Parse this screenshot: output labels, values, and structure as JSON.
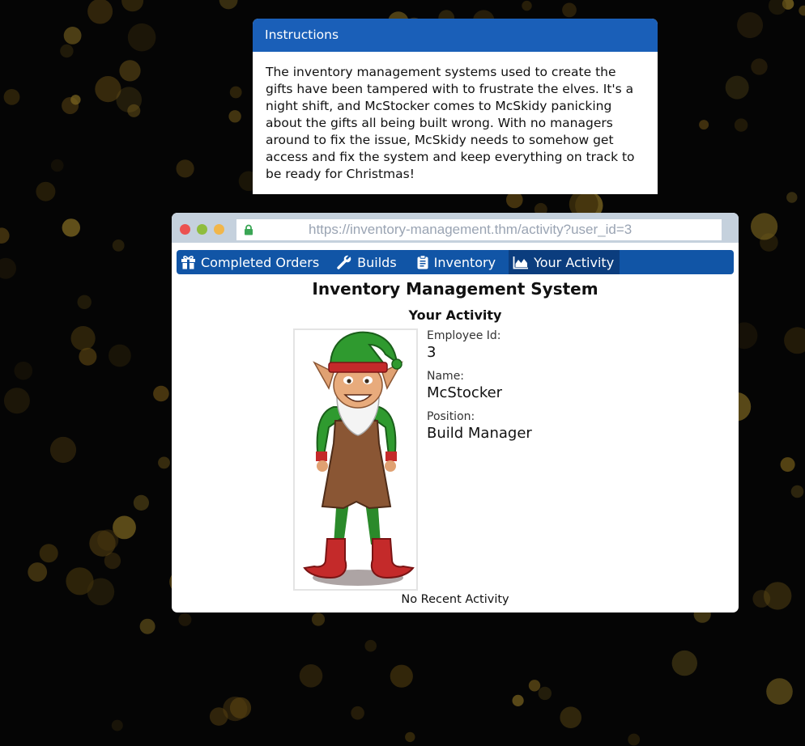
{
  "instructions": {
    "heading": "Instructions",
    "body": "The inventory management systems used to create the gifts have been tampered with to frustrate the elves. It's a night shift, and McStocker comes to McSkidy panicking about the gifts all being built wrong. With no managers around to fix the issue, McSkidy needs to somehow get access and fix the system and keep everything on track to be ready for Christmas!"
  },
  "browser": {
    "url": "https://inventory-management.thm/activity?user_id=3",
    "lock_icon": "lock-icon"
  },
  "nav": {
    "items": [
      {
        "label": "Completed Orders",
        "icon": "gift-icon"
      },
      {
        "label": "Builds",
        "icon": "wrench-icon"
      },
      {
        "label": "Inventory",
        "icon": "clipboard-icon"
      },
      {
        "label": "Your Activity",
        "icon": "area-chart-icon",
        "active": true
      }
    ]
  },
  "page": {
    "title": "Inventory Management System",
    "subtitle": "Your Activity",
    "profile": {
      "image": "elf-avatar",
      "employee_id_label": "Employee Id:",
      "employee_id": "3",
      "name_label": "Name:",
      "name": "McStocker",
      "position_label": "Position:",
      "position": "Build Manager"
    },
    "empty_state": "No Recent Activity"
  },
  "colors": {
    "background": "#050505",
    "header_blue": "#1a5fb8",
    "nav_blue": "#1155a6",
    "nav_active": "#0b3d7e",
    "browser_chrome": "#c5d1dd"
  }
}
